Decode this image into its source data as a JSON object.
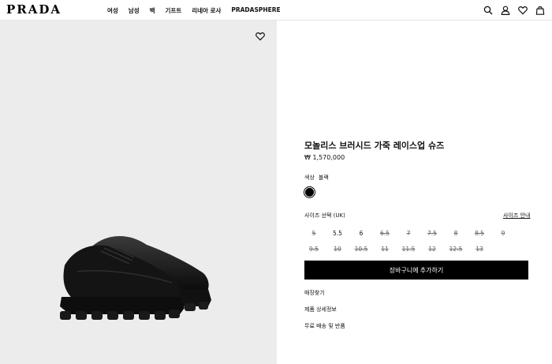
{
  "header": {
    "logo": "PRADA",
    "nav": [
      "여성",
      "남성",
      "백",
      "기프트",
      "리네아 로사",
      "PRADASPHERE"
    ],
    "icons": [
      "search-icon",
      "account-icon",
      "wishlist-icon",
      "bag-icon"
    ]
  },
  "product": {
    "wishlist_icon": "heart-icon",
    "title": "모놀리스 브러시드 가죽 레이스업 슈즈",
    "price": "₩ 1,570,000",
    "color_label": "색상",
    "color_value": "블랙",
    "swatch_color": "#000000",
    "size_label": "사이즈 선택 (UK)",
    "size_guide": "사이즈 안내",
    "sizes": [
      {
        "label": "5",
        "available": false
      },
      {
        "label": "5.5",
        "available": true
      },
      {
        "label": "6",
        "available": true
      },
      {
        "label": "6.5",
        "available": false
      },
      {
        "label": "7",
        "available": false
      },
      {
        "label": "7.5",
        "available": false
      },
      {
        "label": "8",
        "available": false
      },
      {
        "label": "8.5",
        "available": false
      },
      {
        "label": "9",
        "available": false
      },
      {
        "label": "9.5",
        "available": false
      },
      {
        "label": "10",
        "available": false
      },
      {
        "label": "10.5",
        "available": false
      },
      {
        "label": "11",
        "available": false
      },
      {
        "label": "11.5",
        "available": false
      },
      {
        "label": "12",
        "available": false
      },
      {
        "label": "12.5",
        "available": false
      },
      {
        "label": "13",
        "available": false
      }
    ],
    "add_to_cart": "장바구니에 추가하기",
    "links": [
      "매장찾기",
      "제품 상세정보",
      "무료 배송 및 반품"
    ]
  }
}
